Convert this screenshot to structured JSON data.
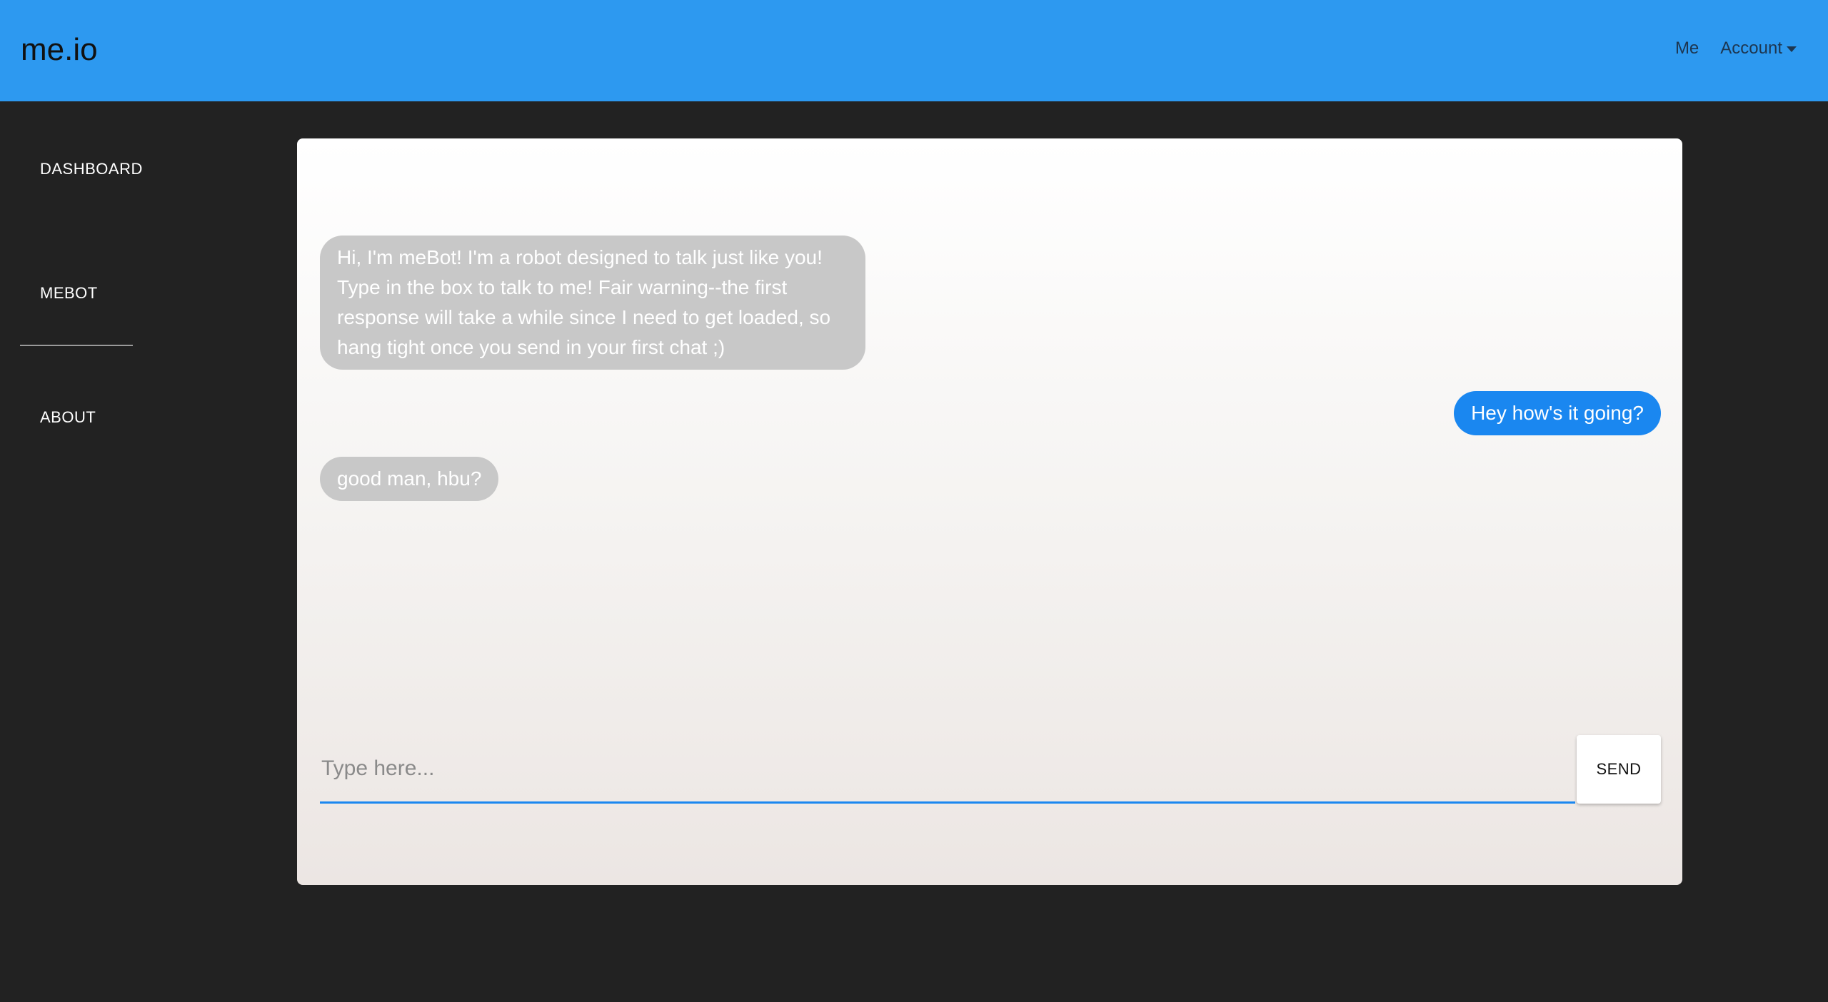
{
  "header": {
    "brand": "me.io",
    "nav": {
      "me_label": "Me",
      "account_label": "Account"
    }
  },
  "sidebar": {
    "items": [
      {
        "label": "DASHBOARD"
      },
      {
        "label": "MEBOT"
      },
      {
        "label": "ABOUT"
      }
    ]
  },
  "chat": {
    "messages": [
      {
        "sender": "bot",
        "text": "Hi, I'm meBot! I'm a robot designed to talk just like you! Type in the box to talk to me! Fair warning--the first response will take a while since I need to get loaded, so hang tight once you send in your first chat ;)"
      },
      {
        "sender": "user",
        "text": "Hey how's it going?"
      },
      {
        "sender": "bot",
        "text": "good man, hbu?"
      }
    ],
    "input": {
      "placeholder": "Type here...",
      "value": ""
    },
    "send_label": "SEND"
  },
  "colors": {
    "header_bg": "#2d99f0",
    "page_bg": "#222222",
    "bot_bubble": "#c8c8c8",
    "user_bubble": "#1a87f0"
  }
}
